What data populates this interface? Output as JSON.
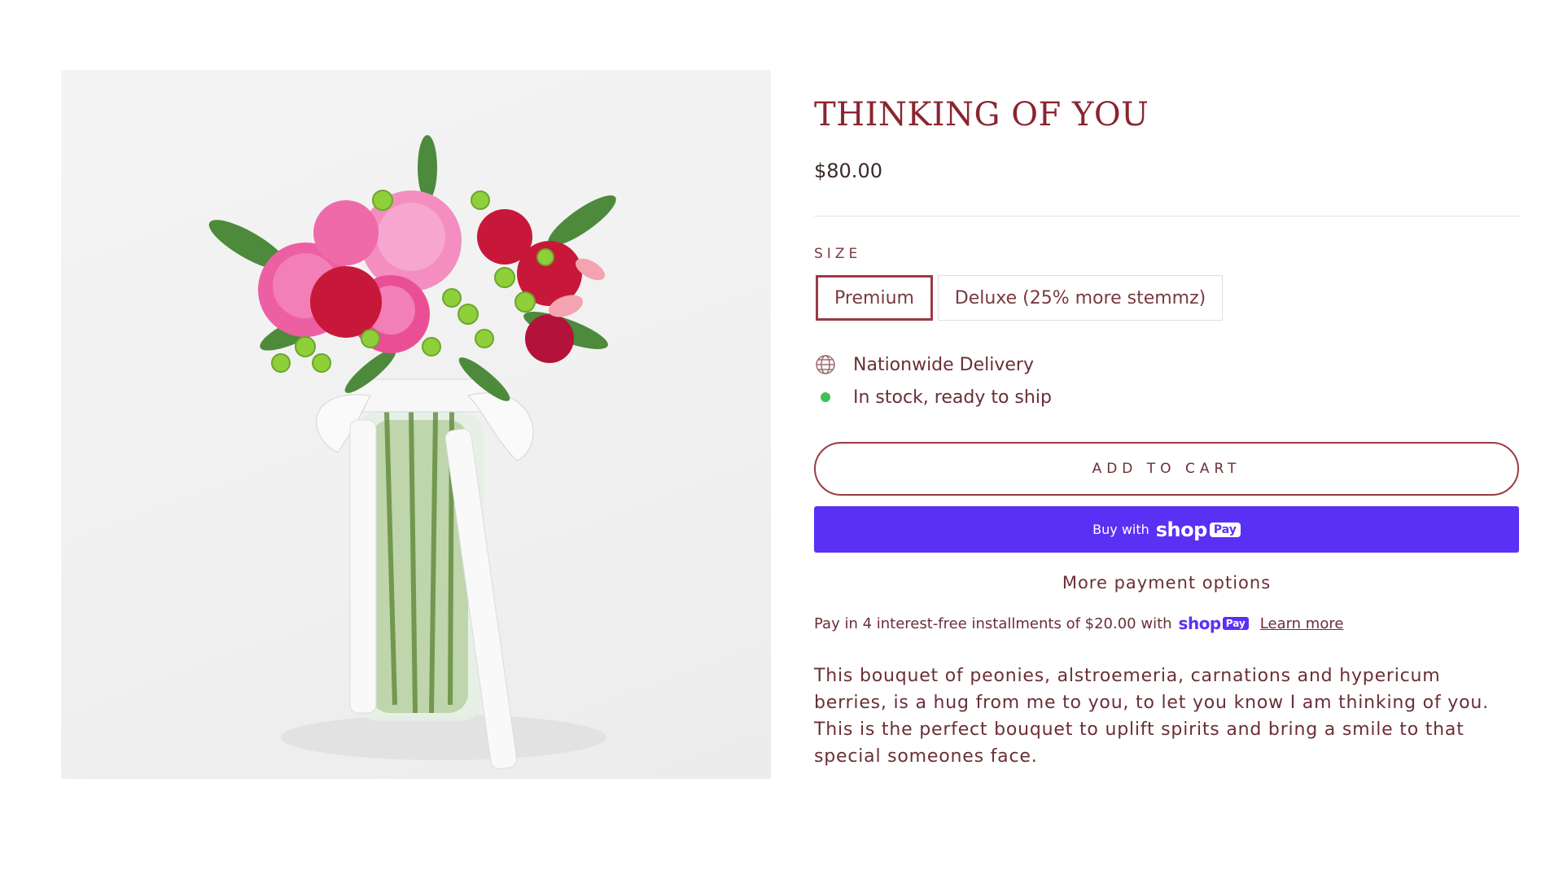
{
  "product": {
    "title": "THINKING OF YOU",
    "price": "$80.00",
    "image_alt": "Bouquet of pink peonies, red carnations and green hypericum berries in a glass jar tied with a STEMMZ ribbon"
  },
  "size": {
    "label": "SIZE",
    "options": [
      "Premium",
      "Deluxe (25% more stemmz)"
    ],
    "selected": "Premium"
  },
  "features": {
    "delivery": "Nationwide Delivery",
    "stock": "In stock, ready to ship"
  },
  "buttons": {
    "add_to_cart": "ADD TO CART",
    "shop_pay_prefix": "Buy with",
    "shop_pay_logo": "shop",
    "shop_pay_pill": "Pay",
    "more_payment": "More payment options"
  },
  "installments": {
    "text": "Pay in 4 interest-free installments of $20.00 with",
    "logo": "shop",
    "pill": "Pay",
    "learn_more": "Learn more"
  },
  "description": "This bouquet of peonies, alstroemeria, carnations and hypericum berries, is a hug from me to you, to let you know I am thinking of you. This is the perfect bouquet to uplift spirits and bring a smile to that special someones face.",
  "colors": {
    "accent": "#8a2530",
    "shop_pay": "#5a31f4",
    "in_stock": "#3ec15a"
  }
}
